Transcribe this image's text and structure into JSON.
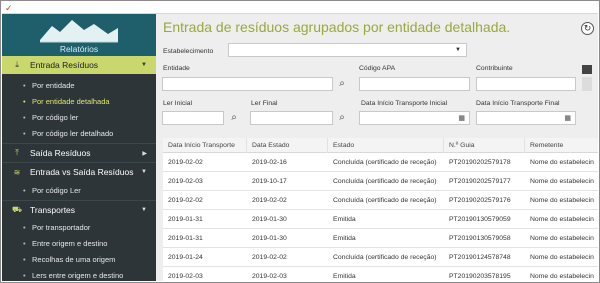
{
  "sidebar": {
    "logo_label": "Relatórios",
    "items": [
      {
        "label": "Entrada Resíduos",
        "icon": "download-icon",
        "expanded": true
      },
      {
        "label": "Saída Resíduos",
        "icon": "upload-icon"
      },
      {
        "label": "Entrada vs Saída Resíduos",
        "icon": "layers-icon"
      },
      {
        "label": "Transportes",
        "icon": "truck-icon"
      }
    ],
    "entrada_sub": [
      "Por entidade",
      "Por entidade detalhada",
      "Por código ler",
      "Por código ler detalhado"
    ],
    "evs_sub": [
      "Por código Ler"
    ],
    "transportes_sub": [
      "Por transportador",
      "Entre origem e destino",
      "Recolhas de uma origem",
      "Lers entre origem e destino"
    ]
  },
  "main": {
    "title": "Entrada de resíduos agrupados por entidade detalhada.",
    "filters": {
      "estabelecimento_label": "Estabelecimento",
      "entidade_label": "Entidade",
      "codigo_apa_label": "Código APA",
      "contribuinte_label": "Contribuinte",
      "ler_inicial_label": "Ler Inicial",
      "ler_final_label": "Ler Final",
      "data_inicio_inicial_label": "Data Início Transporte Inicial",
      "data_inicio_final_label": "Data Início Transporte Final"
    }
  },
  "table": {
    "columns": [
      "Data Início Transporte",
      "Data Estado",
      "Estado",
      "N.º Guia",
      "Remetente"
    ],
    "rows": [
      [
        "2019-02-02",
        "2019-02-16",
        "Concluída (certificado de receção)",
        "PT20190202579178",
        "Nome do estabelecin"
      ],
      [
        "2019-02-03",
        "2019-10-17",
        "Concluída (certificado de receção)",
        "PT20190202579177",
        "Nome do estabelecin"
      ],
      [
        "2019-02-02",
        "2019-02-02",
        "Concluída (certificado de receção)",
        "PT20190202579176",
        "Nome do estabelecin"
      ],
      [
        "2019-01-31",
        "2019-01-30",
        "Emitida",
        "PT20190130579059",
        "Nome do estabelecin"
      ],
      [
        "2019-01-31",
        "2019-01-30",
        "Emitida",
        "PT20190130579058",
        "Nome do estabelecin"
      ],
      [
        "2019-01-24",
        "2019-02-02",
        "Concluída (certificado de receção)",
        "PT20190124578748",
        "Nome do estabelecin"
      ],
      [
        "2019-02-03",
        "2019-02-03",
        "Emitida",
        "PT20190203578195",
        "Nome do estabelecin"
      ]
    ]
  }
}
